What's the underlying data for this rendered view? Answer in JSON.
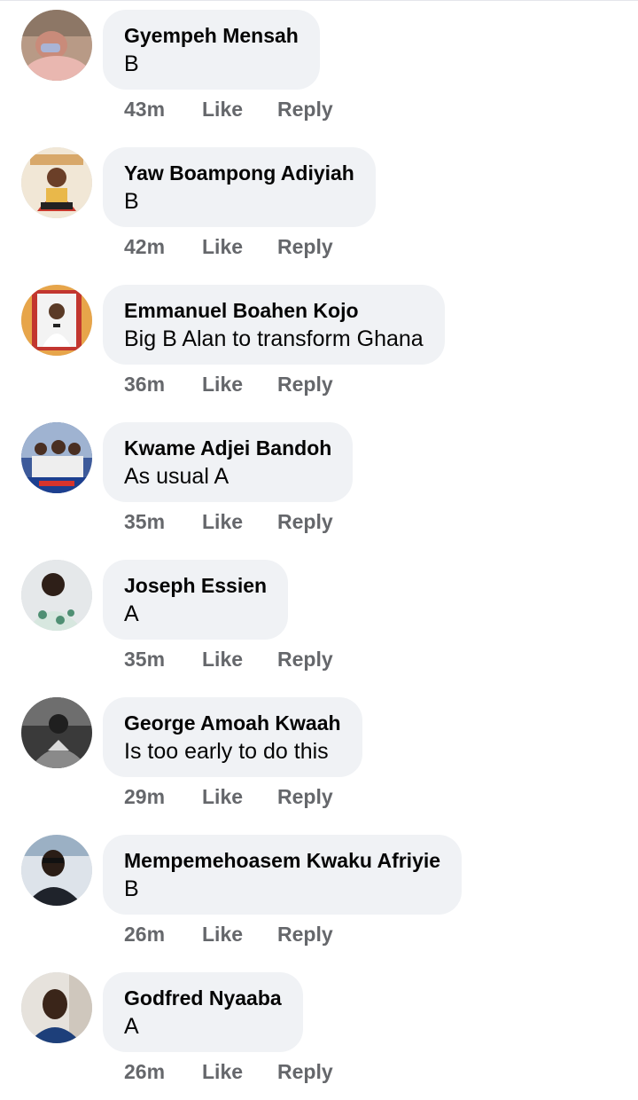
{
  "comments": [
    {
      "author": "Gyempeh Mensah",
      "text": "B",
      "time": "43m",
      "like": "Like",
      "reply": "Reply"
    },
    {
      "author": "Yaw Boampong Adiyiah",
      "text": "B",
      "time": "42m",
      "like": "Like",
      "reply": "Reply"
    },
    {
      "author": "Emmanuel Boahen Kojo",
      "text": "Big B Alan to transform Ghana",
      "time": "36m",
      "like": "Like",
      "reply": "Reply"
    },
    {
      "author": "Kwame Adjei Bandoh",
      "text": "As usual A",
      "time": "35m",
      "like": "Like",
      "reply": "Reply"
    },
    {
      "author": "Joseph Essien",
      "text": "A",
      "time": "35m",
      "like": "Like",
      "reply": "Reply"
    },
    {
      "author": "George Amoah Kwaah",
      "text": "Is too early to do this",
      "time": "29m",
      "like": "Like",
      "reply": "Reply"
    },
    {
      "author": "Mempemehoasem Kwaku Afriyie",
      "text": "B",
      "time": "26m",
      "like": "Like",
      "reply": "Reply"
    },
    {
      "author": "Godfred Nyaaba",
      "text": "A",
      "time": "26m",
      "like": "Like",
      "reply": "Reply"
    }
  ],
  "colors": {
    "bubble_background": "#f0f2f5",
    "author_text": "#050505",
    "meta_text": "#65676b"
  }
}
